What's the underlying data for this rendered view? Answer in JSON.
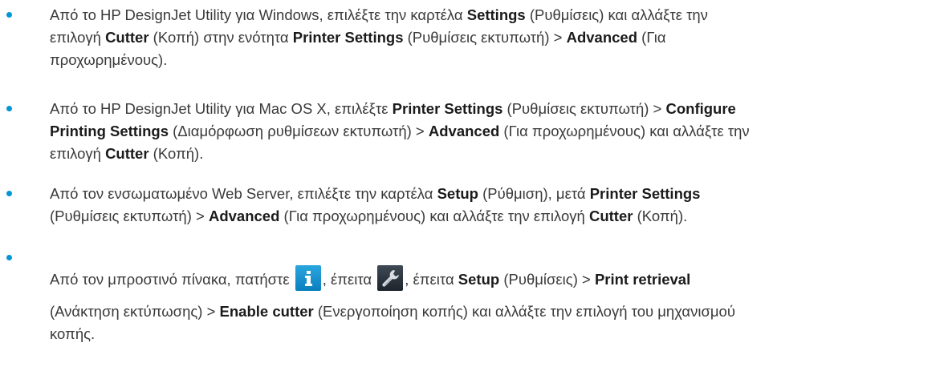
{
  "accent_color": "#0096d6",
  "items": [
    {
      "line1": {
        "t1": "Από το HP DesignJet Utility για Windows, επιλέξτε την καρτέλα ",
        "b1": "Settings",
        "t2": " (Ρυθμίσεις) και αλλάξτε την"
      },
      "line2": {
        "t1": "επιλογή ",
        "b1": "Cutter",
        "t2": " (Κοπή) στην ενότητα ",
        "b2": "Printer Settings",
        "t3": " (Ρυθμίσεις εκτυπωτή) > ",
        "b3": "Advanced",
        "t4": " (Για"
      },
      "line3": {
        "t1": "προχωρημένους)."
      }
    },
    {
      "line1": {
        "t1": "Από το HP DesignJet Utility για Mac OS X, επιλέξτε ",
        "b1": "Printer Settings",
        "t2": " (Ρυθμίσεις εκτυπωτή) > ",
        "b2": "Configure"
      },
      "line2": {
        "b1": "Printing Settings",
        "t1": " (Διαμόρφωση ρυθμίσεων εκτυπωτή) > ",
        "b2": "Advanced",
        "t2": " (Για προχωρημένους) και αλλάξτε την"
      },
      "line3": {
        "t1": "επιλογή ",
        "b1": "Cutter",
        "t2": " (Κοπή)."
      }
    },
    {
      "line1": {
        "t1": "Από τον ενσωματωμένο Web Server, επιλέξτε την καρτέλα ",
        "b1": "Setup",
        "t2": " (Ρύθμιση), μετά ",
        "b2": "Printer Settings"
      },
      "line2": {
        "t1": "(Ρυθμίσεις εκτυπωτή) > ",
        "b1": "Advanced",
        "t2": " (Για προχωρημένους) και αλλάξτε την επιλογή ",
        "b2": "Cutter",
        "t3": " (Κοπή)."
      }
    },
    {
      "line1": {
        "t1": "Από τον μπροστινό πίνακα, πατήστε ",
        "icon1": "info-icon",
        "t2": ", έπειτα ",
        "icon2": "wrench-icon",
        "t3": ", έπειτα ",
        "b1": "Setup",
        "t4": " (Ρυθμίσεις) > ",
        "b2": "Print retrieval"
      },
      "line2": {
        "t1": "(Ανάκτηση εκτύπωσης) > ",
        "b1": "Enable cutter",
        "t2": " (Ενεργοποίηση κοπής) και αλλάξτε την επιλογή του μηχανισμού"
      },
      "line3": {
        "t1": "κοπής."
      }
    }
  ]
}
